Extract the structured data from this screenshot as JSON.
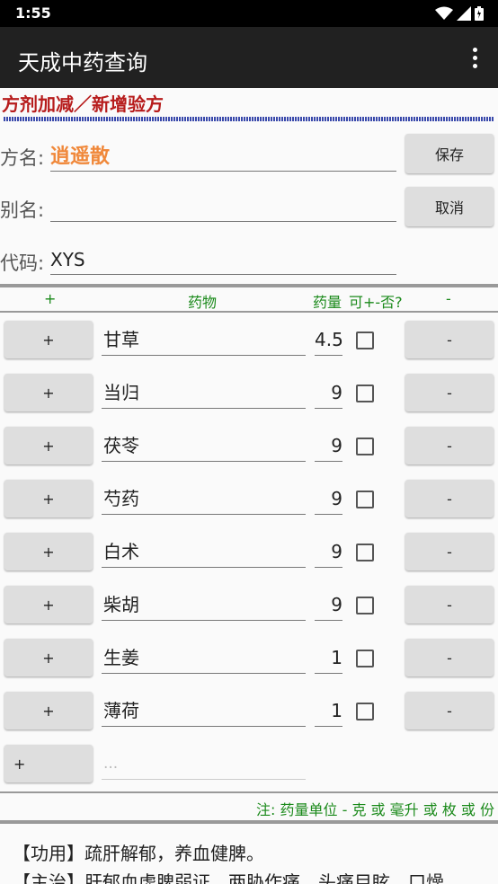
{
  "status_bar": {
    "time": "1:55",
    "icons": [
      "wifi-icon",
      "signal-icon",
      "battery-icon"
    ]
  },
  "app_bar": {
    "title": "天成中药查询",
    "menu_icon": "more-vert-icon"
  },
  "section_title": "方剂加减／新增验方",
  "form": {
    "name_label": "方名:",
    "name_value": "逍遥散",
    "alias_label": "别名:",
    "alias_value": "",
    "code_label": "代码:",
    "code_value": "XYS",
    "save_label": "保存",
    "cancel_label": "取消"
  },
  "table": {
    "headers": {
      "add": "+",
      "herb": "药物",
      "dose": "药量",
      "flag": "可+-否?",
      "remove": "-"
    },
    "add_label": "+",
    "remove_label": "-",
    "rows": [
      {
        "herb": "甘草",
        "dose": "4.5",
        "checked": false
      },
      {
        "herb": "当归",
        "dose": "9",
        "checked": false
      },
      {
        "herb": "茯苓",
        "dose": "9",
        "checked": false
      },
      {
        "herb": "芍药",
        "dose": "9",
        "checked": false
      },
      {
        "herb": "白术",
        "dose": "9",
        "checked": false
      },
      {
        "herb": "柴胡",
        "dose": "9",
        "checked": false
      },
      {
        "herb": "生姜",
        "dose": "1",
        "checked": false
      },
      {
        "herb": "薄荷",
        "dose": "1",
        "checked": false
      }
    ],
    "new_row": {
      "add_label": "+",
      "placeholder": "..."
    }
  },
  "note": "注: 药量单位 - 克 或 毫升 或 枚 或 份",
  "description": {
    "effect": "【功用】疏肝解郁，养血健脾。",
    "indication": "【主治】肝郁血虚脾弱证。两胁作痛，头痛目眩，口燥"
  },
  "colors": {
    "accent_red": "#b71c1c",
    "name_orange": "#f0883a",
    "header_green": "#1b8a1b",
    "app_bar": "#212121"
  }
}
